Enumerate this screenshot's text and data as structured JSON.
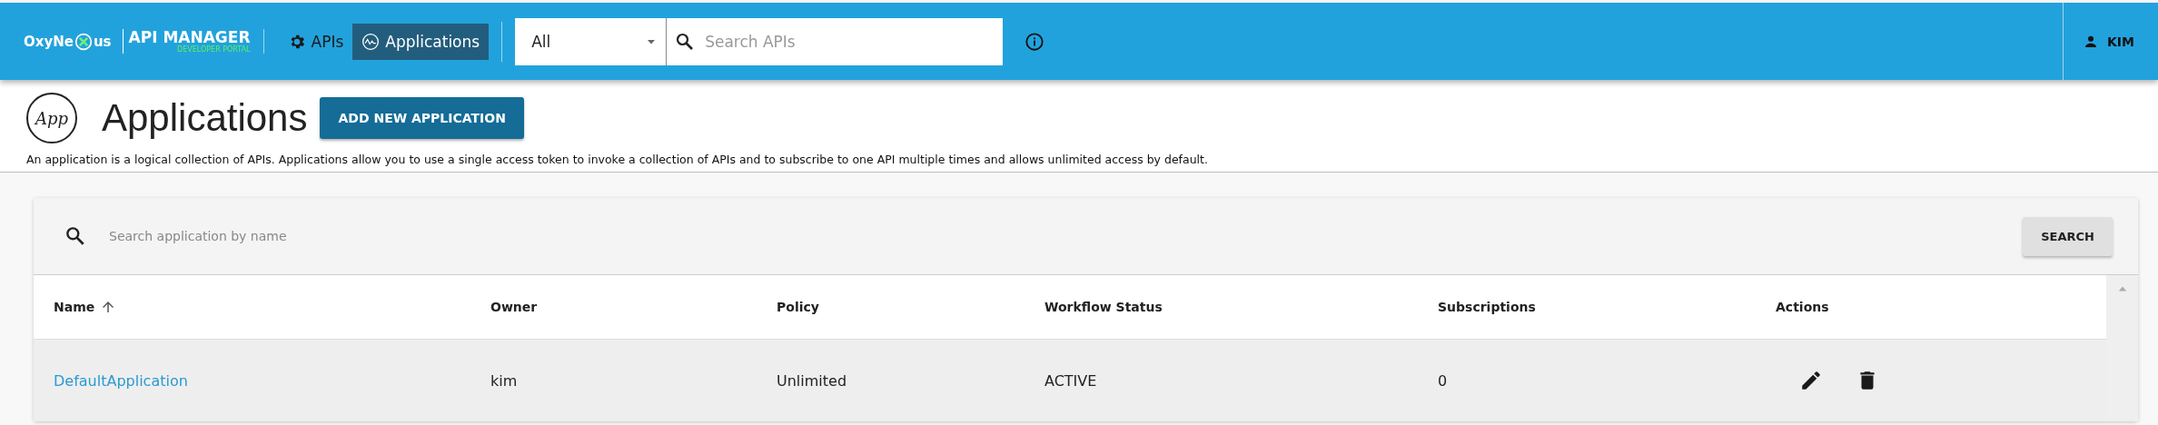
{
  "header": {
    "brand": {
      "before": "OxyNe",
      "after": "us"
    },
    "product": "API MANAGER",
    "product_subtitle": "DEVELOPER PORTAL",
    "nav_tabs": [
      {
        "label": "APIs",
        "kind": "gear",
        "selected": false
      },
      {
        "label": "Applications",
        "kind": "app",
        "selected": true
      }
    ],
    "scope_select": {
      "value": "All"
    },
    "search": {
      "placeholder": "Search APIs"
    },
    "user": "KIM"
  },
  "page": {
    "icon_text": "App",
    "title": "Applications",
    "add_button": "ADD NEW APPLICATION",
    "description": "An application is a logical collection of APIs. Applications allow you to use a single access token to invoke a collection of APIs and to subscribe to one API multiple times and allows unlimited access by default."
  },
  "table": {
    "search": {
      "placeholder": "Search application by name"
    },
    "search_button": "SEARCH",
    "columns": [
      {
        "label": "Name",
        "sorted": true
      },
      {
        "label": "Owner",
        "sorted": false
      },
      {
        "label": "Policy",
        "sorted": false
      },
      {
        "label": "Workflow Status",
        "sorted": false
      },
      {
        "label": "Subscriptions",
        "sorted": false
      },
      {
        "label": "Actions",
        "sorted": false
      }
    ],
    "rows": [
      {
        "name": "DefaultApplication",
        "owner": "kim",
        "policy": "Unlimited",
        "workflow_status": "ACTIVE",
        "subscriptions": "0"
      }
    ]
  }
}
